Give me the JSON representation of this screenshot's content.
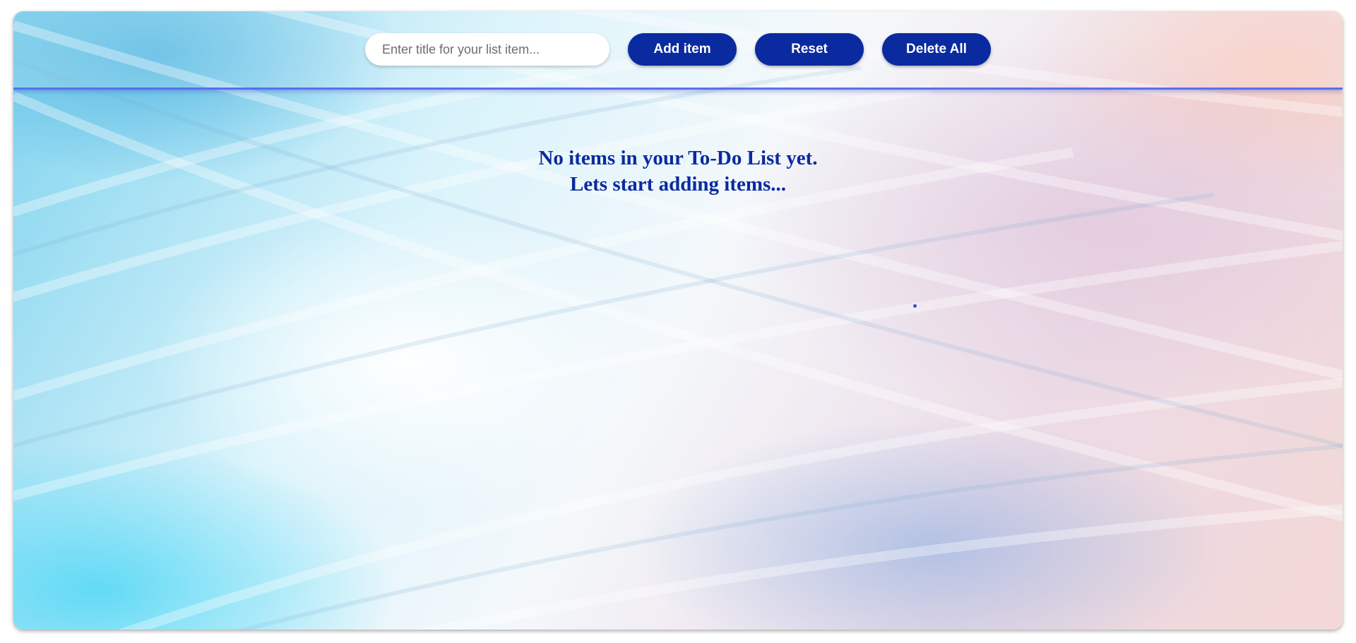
{
  "header": {
    "input_placeholder": "Enter title for your list item...",
    "input_value": "",
    "add_label": "Add item",
    "reset_label": "Reset",
    "delete_all_label": "Delete All"
  },
  "empty_state": {
    "line1": "No items in your To-Do List yet.",
    "line2": "Lets start adding items..."
  },
  "colors": {
    "accent": "#0a2aa0",
    "header_border": "#5a6ef0"
  }
}
